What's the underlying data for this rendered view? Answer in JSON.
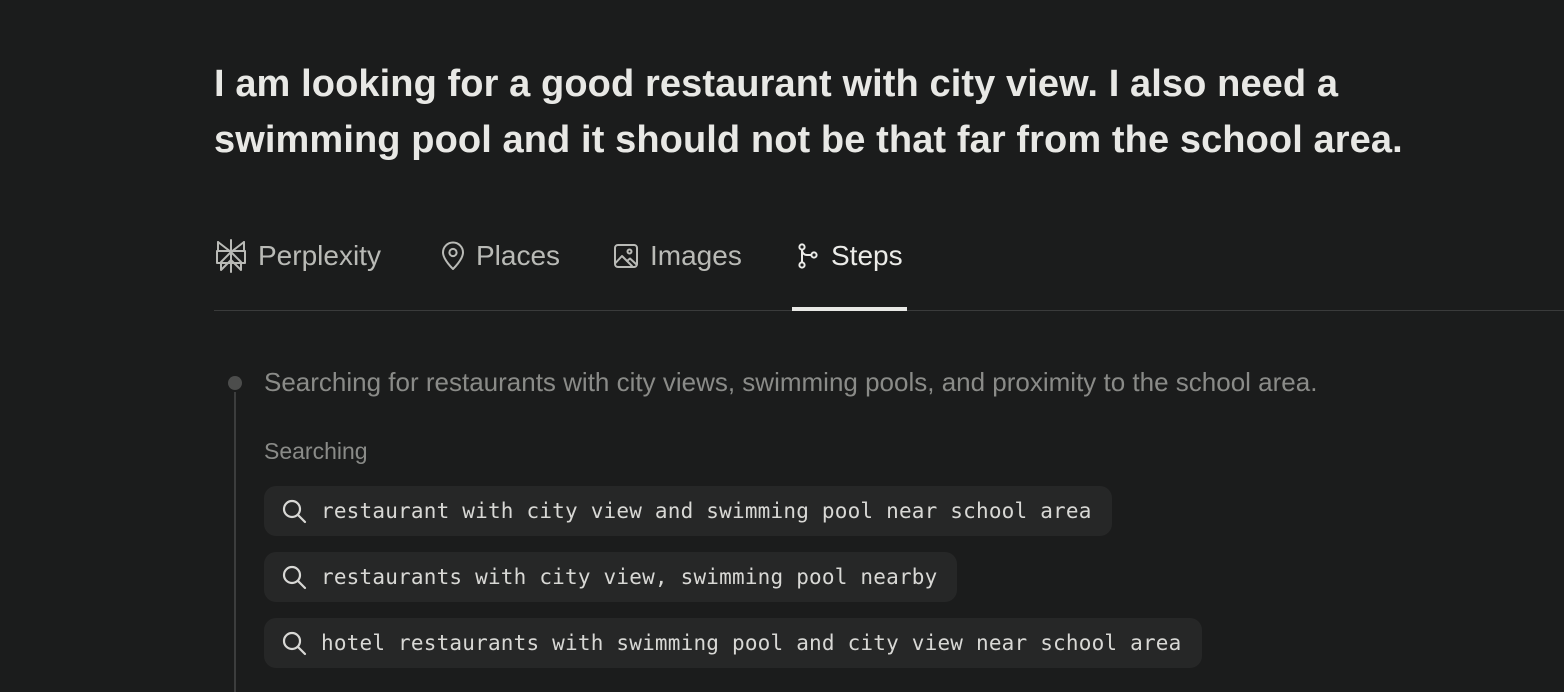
{
  "query": {
    "text": "I am looking for a good restaurant with city view. I also need a swimming pool and it should not be that far from the school area."
  },
  "tabs": [
    {
      "label": "Perplexity",
      "icon": "perplexity-logo-icon",
      "active": false
    },
    {
      "label": "Places",
      "icon": "map-pin-icon",
      "active": false
    },
    {
      "label": "Images",
      "icon": "image-icon",
      "active": false
    },
    {
      "label": "Steps",
      "icon": "git-branch-icon",
      "active": true
    }
  ],
  "steps": {
    "step_text": "Searching for restaurants with city views, swimming pools, and proximity to the school area.",
    "searching_label": "Searching",
    "queries": [
      "restaurant with city view and swimming pool near school area",
      "restaurants with city view, swimming pool nearby",
      "hotel restaurants with swimming pool and city view near school area"
    ]
  },
  "colors": {
    "background": "#1b1c1c",
    "text_primary": "#e8e8e5",
    "text_muted": "#8a8b88",
    "pill_background": "#262727",
    "active_underline": "#e8e8e5"
  }
}
